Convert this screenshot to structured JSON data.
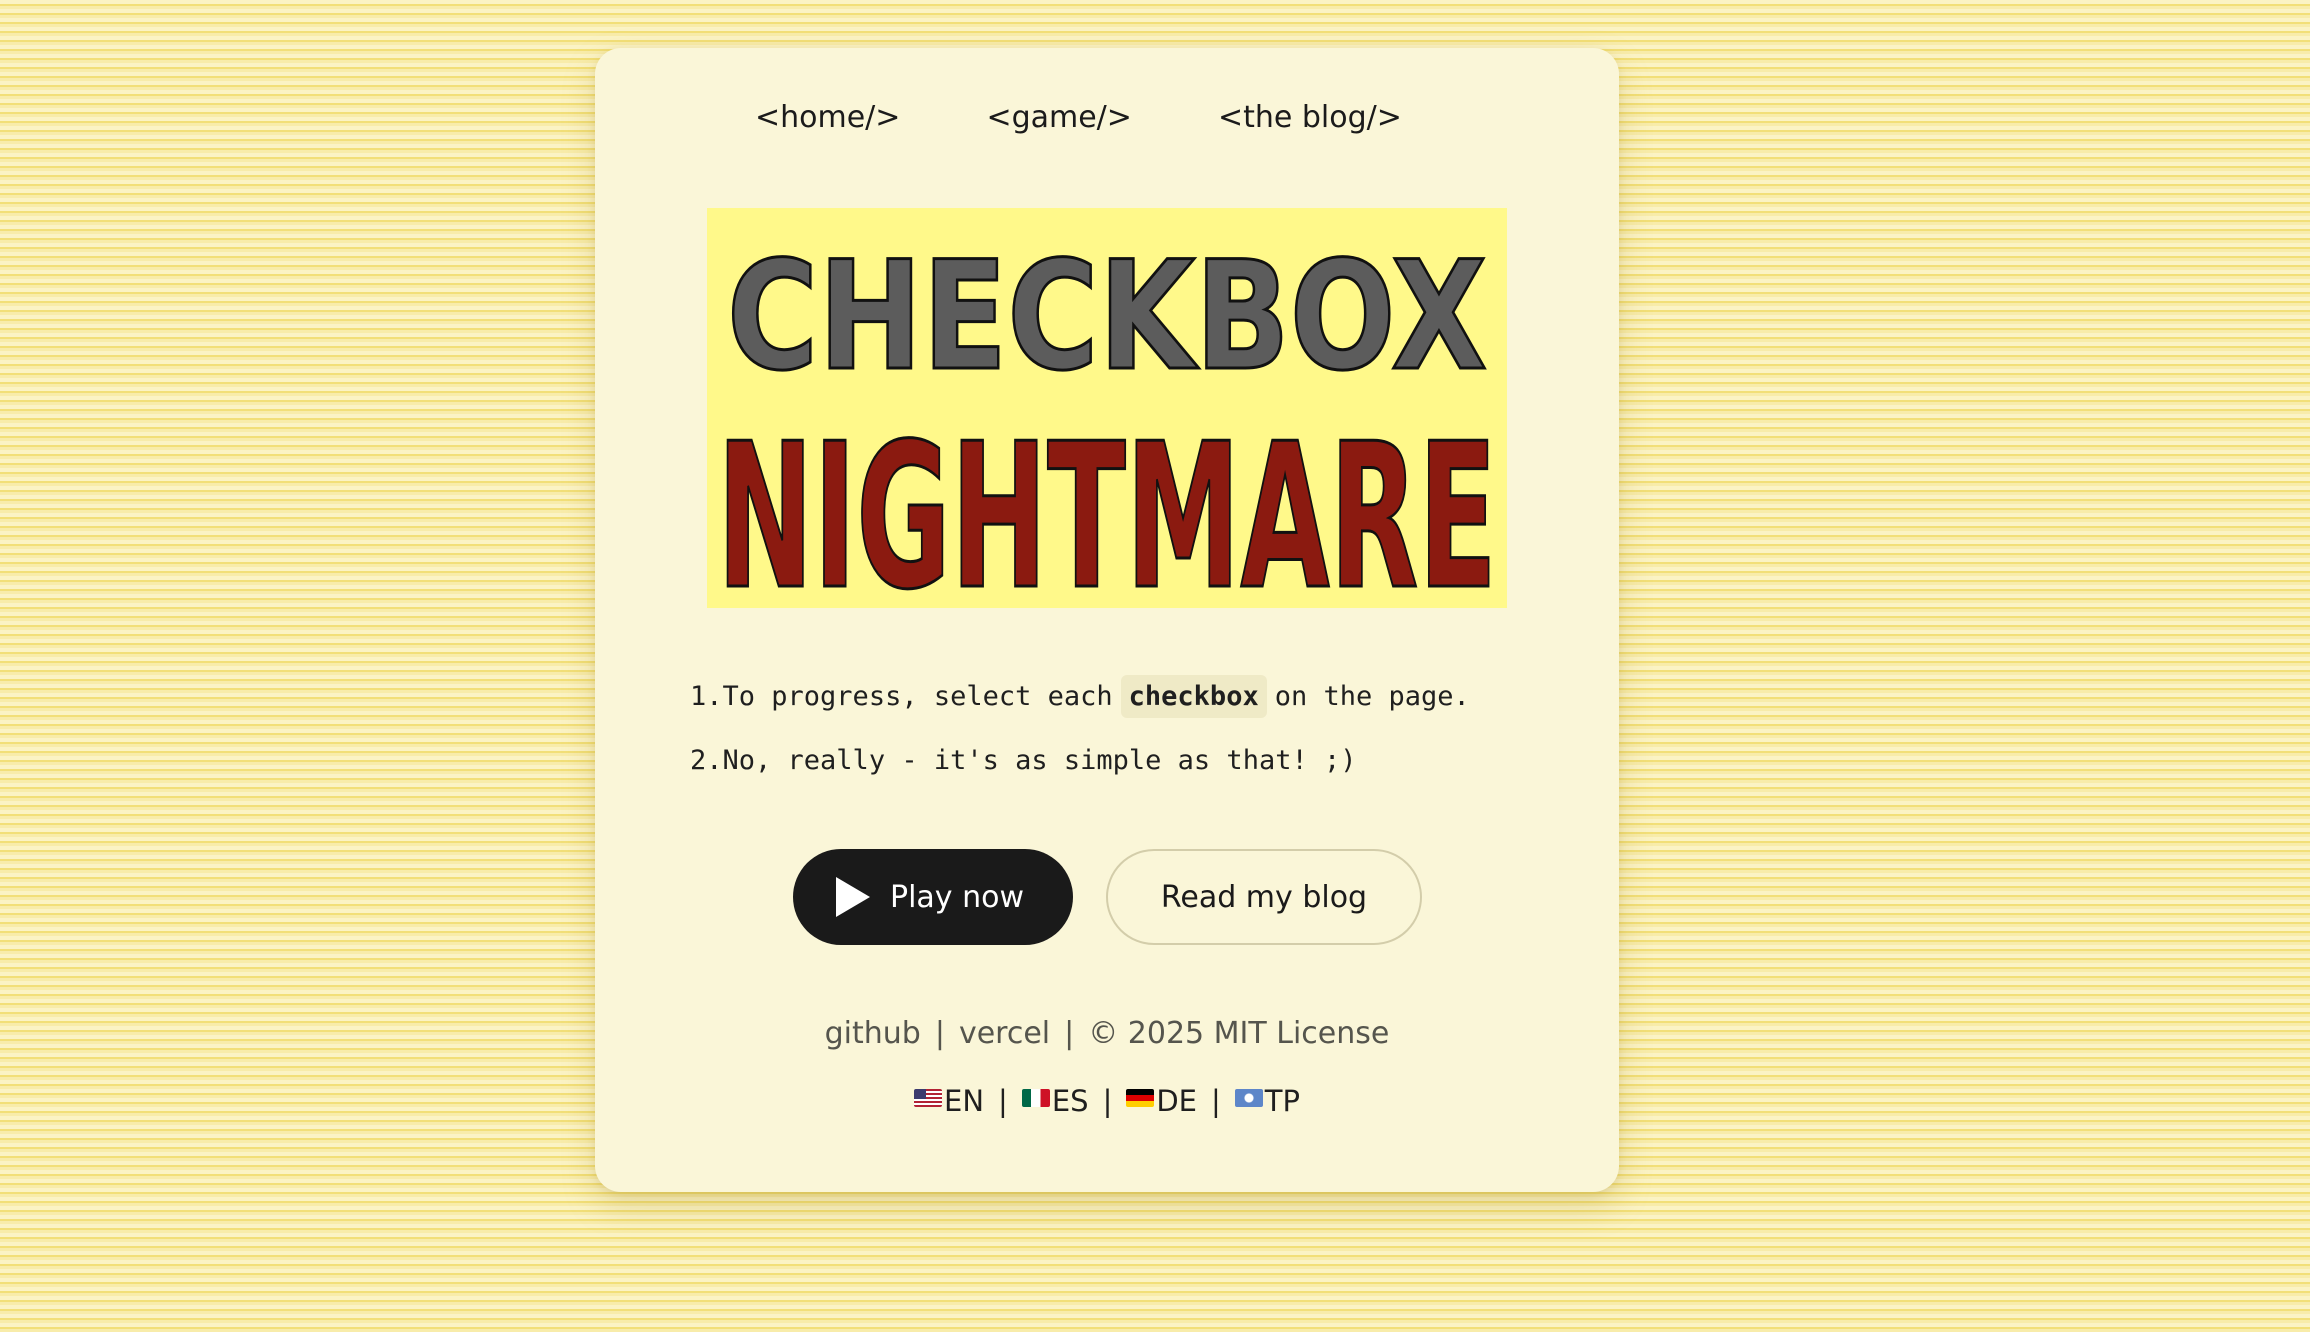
{
  "nav": {
    "items": [
      {
        "label": "<home/>"
      },
      {
        "label": "<game/>"
      },
      {
        "label": "<the blog/>"
      }
    ]
  },
  "logo": {
    "line1": "CHECKBOX",
    "line2": "NIGHTMARE",
    "colors": {
      "background": "#fff98a",
      "line1": "#5c5c5c",
      "line2": "#8b1a10"
    }
  },
  "steps": [
    {
      "num": "1.",
      "before": "To progress, select each",
      "code": "checkbox",
      "after": "on the page."
    },
    {
      "num": "2.",
      "text": "No, really - it's as simple as that! ;)"
    }
  ],
  "buttons": {
    "play": {
      "label": "Play now",
      "icon": "play-icon"
    },
    "blog": {
      "label": "Read my blog"
    }
  },
  "footer": {
    "links": [
      {
        "label": "github"
      },
      {
        "label": "vercel"
      }
    ],
    "license": "© 2025 MIT License",
    "separator": "|"
  },
  "languages": [
    {
      "code": "EN",
      "flag": "flag-us-icon"
    },
    {
      "code": "ES",
      "flag": "flag-mx-icon"
    },
    {
      "code": "DE",
      "flag": "flag-de-icon"
    },
    {
      "code": "TP",
      "flag": "flag-tp-icon"
    }
  ]
}
